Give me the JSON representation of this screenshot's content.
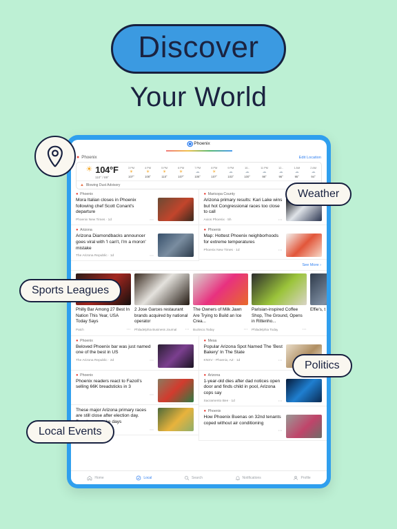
{
  "hero": {
    "pill_title": "Discover",
    "subtitle": "Your World"
  },
  "callouts": {
    "pin_icon": "map-pin-icon",
    "weather": "Weather",
    "sports": "Sports Leagues",
    "politics": "Politics",
    "local_events": "Local Events"
  },
  "app": {
    "tab": {
      "label": "Phoenix",
      "icon": "location-dot-icon"
    },
    "location_bar": {
      "pin_icon": "map-pin-icon",
      "name": "Phoenix",
      "edit_label": "Edit Location"
    },
    "weather": {
      "icon": "sun-icon",
      "temperature": "104°F",
      "high_low": "110° / 89°",
      "alert_icon": "warning-triangle-icon",
      "alert_text": "Blowing Dust Advisory",
      "hours": [
        {
          "time": "3 PM",
          "icon": "sun",
          "temp": "107°"
        },
        {
          "time": "4 PM",
          "icon": "sun",
          "temp": "108°"
        },
        {
          "time": "5 PM",
          "icon": "sun",
          "temp": "110°"
        },
        {
          "time": "6 PM",
          "icon": "sun",
          "temp": "107°"
        },
        {
          "time": "7 PM",
          "icon": "cloud",
          "temp": "106°"
        },
        {
          "time": "8 PM",
          "icon": "sun",
          "temp": "107°"
        },
        {
          "time": "9 PM",
          "icon": "cloud",
          "temp": "103°"
        },
        {
          "time": "10...",
          "icon": "cloud",
          "temp": "100°"
        },
        {
          "time": "11 PM",
          "icon": "cloud",
          "temp": "98°"
        },
        {
          "time": "12...",
          "icon": "cloud",
          "temp": "96°"
        },
        {
          "time": "1 AM",
          "icon": "cloud",
          "temp": "95°"
        },
        {
          "time": "2 AM",
          "icon": "cloud",
          "temp": "94°"
        }
      ]
    },
    "see_more": "See More ›",
    "articles_top_left": [
      {
        "location": "Phoenix",
        "title": "Mora Italian closes in Phoenix following chef Scott Conant's departure",
        "source": "Phoenix New Times · 1d",
        "thumb": "restaurant-interior"
      },
      {
        "location": "Arizona",
        "title": "Arizona Diamondbacks announcer goes viral with 'I can't, I'm a moron' mistake",
        "source": "The Arizona Republic · 1d",
        "thumb": "broadcast-booth"
      }
    ],
    "articles_top_right": [
      {
        "location": "Maricopa County",
        "title": "Arizona primary results: Kari Lake wins but hot Congressional races too close to call",
        "source": "Axios Phoenix · 5h",
        "thumb": "politician-speaking"
      },
      {
        "location": "Phoenix",
        "title": "Map: Hottest Phoenix neighborhoods for extreme temperatures",
        "source": "Phoenix New Times · 1d",
        "thumb": "heat-map"
      }
    ],
    "carousel": [
      {
        "title": "Philly Bar Among 27 Best In Nation This Year, USA Today Says",
        "source": "Patch",
        "img": "cocktail-bar"
      },
      {
        "title": "2 Jose Garces restaurant brands acquired by national operator",
        "source": "Philadelphia Business Journal",
        "img": "chef-portrait"
      },
      {
        "title": "The Owners of Milk Jawn Are Trying to Build an Ice Crea...",
        "source": "Bucksco.Today",
        "img": "ice-cream-shop"
      },
      {
        "title": "Parisian-inspired Coffee Shop, The Ground, Opens in Rittenho...",
        "source": "Philadelphia Today",
        "img": "coffee-counter"
      },
      {
        "title": "Effie's, t Restaura in Cente",
        "source": "",
        "img": "storefront"
      }
    ],
    "articles_bottom_left": [
      {
        "location": "Phoenix",
        "title": "Beloved Phoenix bar was just named one of the best in US",
        "source": "The Arizona Republic · 2d",
        "thumb": "bartender"
      },
      {
        "location": "Phoenix",
        "title": "Phoenix readers react to Fazoli's selling 66K breadsticks in 3",
        "source": "",
        "thumb": "fazolis-sign"
      },
      {
        "location": "",
        "title": "These major Arizona primary races are still close after election day. Results may take days",
        "source": "",
        "thumb": "polling-place"
      }
    ],
    "articles_bottom_right": [
      {
        "location": "Mesa",
        "title": "Popular Arizona Spot Named The 'Best Bakery' In The State",
        "source": "KNXV - Phoenix, AZ · 1d",
        "thumb": "bakery-pastries"
      },
      {
        "location": "Arizona",
        "title": "1-year-old dies after dad notices open door and finds child in pool, Arizona cops say",
        "source": "Sacramento Bee · 1d",
        "thumb": "swimming-pool"
      },
      {
        "location": "Phoenix",
        "title": "How Phoenix Buenas on 32nd tenants coped without air conditioning",
        "source": "",
        "thumb": "woman-portrait"
      }
    ],
    "nav": [
      {
        "label": "Home",
        "icon": "home-icon",
        "active": false
      },
      {
        "label": "Local",
        "icon": "location-icon",
        "active": true
      },
      {
        "label": "Search",
        "icon": "search-icon",
        "active": false
      },
      {
        "label": "Notifications",
        "icon": "bell-icon",
        "active": false
      },
      {
        "label": "Profile",
        "icon": "person-icon",
        "active": false
      }
    ]
  },
  "colors": {
    "background": "#bdf0d4",
    "accent_blue": "#2f9fee",
    "pill_blue": "#3b9ae1",
    "ink": "#17203f",
    "callout_bg": "#faf7f0"
  }
}
